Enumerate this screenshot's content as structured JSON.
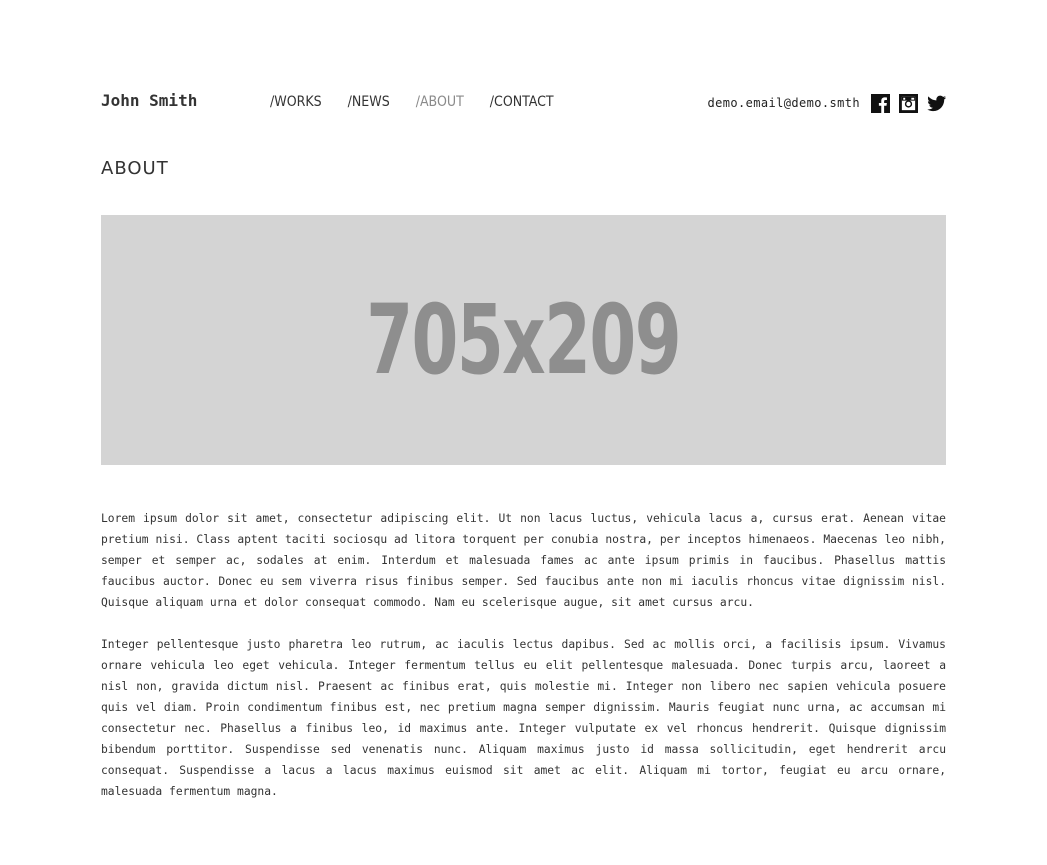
{
  "header": {
    "logo": "John Smith",
    "nav": [
      {
        "label": "/WORKS",
        "active": false
      },
      {
        "label": "/NEWS",
        "active": false
      },
      {
        "label": "/ABOUT",
        "active": true
      },
      {
        "label": "/CONTACT",
        "active": false
      }
    ],
    "email": "demo.email@demo.smth",
    "social_icons": [
      "facebook-icon",
      "instagram-icon",
      "twitter-icon"
    ]
  },
  "main": {
    "title": "ABOUT",
    "image_placeholder": "705x209",
    "paragraphs": [
      "Lorem ipsum dolor sit amet, consectetur adipiscing elit. Ut non lacus luctus, vehicula lacus a, cursus erat. Aenean vitae pretium nisi. Class aptent taciti sociosqu ad litora torquent per conubia nostra, per inceptos himenaeos. Maecenas leo nibh, semper et semper ac, sodales at enim. Interdum et malesuada fames ac ante ipsum primis in faucibus. Phasellus mattis faucibus auctor. Donec eu sem viverra risus finibus semper. Sed faucibus ante non mi iaculis rhoncus vitae dignissim nisl. Quisque aliquam urna et dolor consequat commodo. Nam eu scelerisque augue, sit amet cursus arcu.",
      "Integer pellentesque justo pharetra leo rutrum, ac iaculis lectus dapibus. Sed ac mollis orci, a facilisis ipsum. Vivamus ornare vehicula leo eget vehicula. Integer fermentum tellus eu elit pellentesque malesuada. Donec turpis arcu, laoreet a nisl non, gravida dictum nisl. Praesent ac finibus erat, quis molestie mi. Integer non libero nec sapien vehicula posuere quis vel diam. Proin condimentum finibus est, nec pretium magna semper dignissim. Mauris feugiat nunc urna, ac accumsan mi consectetur nec. Phasellus a finibus leo, id maximus ante. Integer vulputate ex vel rhoncus hendrerit. Quisque dignissim bibendum porttitor. Suspendisse sed venenatis nunc. Aliquam maximus justo id massa sollicitudin, eget hendrerit arcu consequat. Suspendisse a lacus a lacus maximus euismod sit amet ac elit. Aliquam mi tortor, feugiat eu arcu ornare, malesuada fermentum magna."
    ]
  },
  "colors": {
    "text": "#333333",
    "nav_active": "#8a8a8a",
    "placeholder_bg": "#d4d4d4",
    "placeholder_text": "#8e8e8e"
  }
}
